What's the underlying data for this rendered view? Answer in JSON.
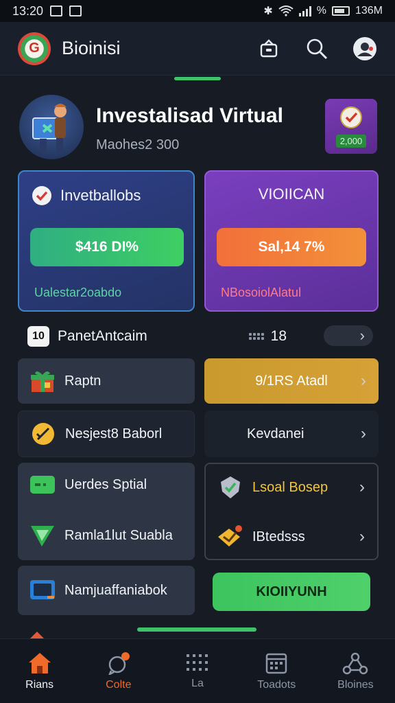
{
  "status": {
    "time": "13:20",
    "battery": "%",
    "right_text": "136M"
  },
  "app": {
    "title": "Bioinisi"
  },
  "hero": {
    "title": "Investalisad Virtual",
    "subtitle": "Maohes2 300",
    "badge": "2,000"
  },
  "cards": {
    "blue": {
      "title": "Invetballobs",
      "button": "$416 DI%",
      "footer": "Ualestar2oabdo"
    },
    "purple": {
      "title": "VIOIICAN",
      "button": "Sal,14 7%",
      "footer": "NBosoiolAlatul"
    }
  },
  "stats": {
    "chip": "10",
    "label": "PanetAntcaim",
    "count": "18"
  },
  "tiles": {
    "raptn": "Raptn",
    "gold_action": "9/1RS Atadl",
    "nesjest": "Nesjest8 Baborl",
    "kevdanei": "Kevdanei",
    "uerdes": "Uerdes Sptial",
    "ramla": "Ramla1lut Suabla",
    "lsoal": "Lsoal Bosep",
    "ibtedsss": "IBtedsss",
    "namjuaffan": "Namjuaffaniabok",
    "green_btn": "KIOIIYUNH"
  },
  "colors": {
    "accent_green": "#3dc46a",
    "blue_card": "#2e3f86",
    "purple_card": "#7a3fbf",
    "orange": "#f2913a",
    "gold": "#d6a136"
  },
  "nav": [
    {
      "label": "Rians",
      "icon": "home-icon"
    },
    {
      "label": "Colte",
      "icon": "chat-icon"
    },
    {
      "label": "La",
      "icon": "grid-icon"
    },
    {
      "label": "Toadots",
      "icon": "calendar-icon"
    },
    {
      "label": "Bloines",
      "icon": "network-icon"
    }
  ]
}
